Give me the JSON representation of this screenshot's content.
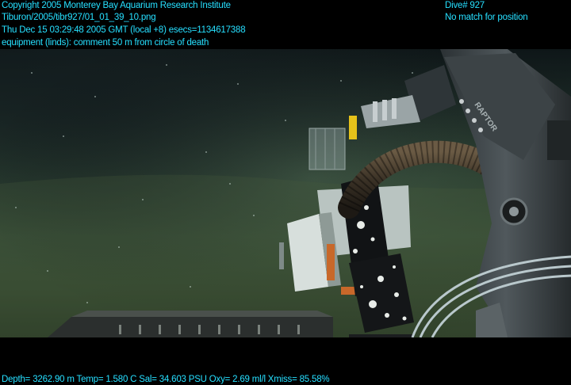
{
  "overlay": {
    "copyright": "Copyright 2005 Monterey Bay Aquarium Research Institute",
    "filename": "Tiburon/2005/tibr927/01_01_39_10.png",
    "datetime": "Thu Dec 15 03:29:48 2005 GMT (local +8)  esecs=1134617388",
    "comment": "equipment (linds): comment 50 m from circle of death",
    "dive": "Dive# 927",
    "position": "No match for position",
    "telemetry": "Depth= 3262.90 m  Temp= 1.580 C  Sal= 34.603 PSU  Oxy= 2.69 ml/l  Xmiss= 85.58%"
  },
  "scene": {
    "arm_label": "RAPTOR"
  },
  "colors": {
    "overlay_text": "#26e1f4",
    "background": "#000000"
  }
}
